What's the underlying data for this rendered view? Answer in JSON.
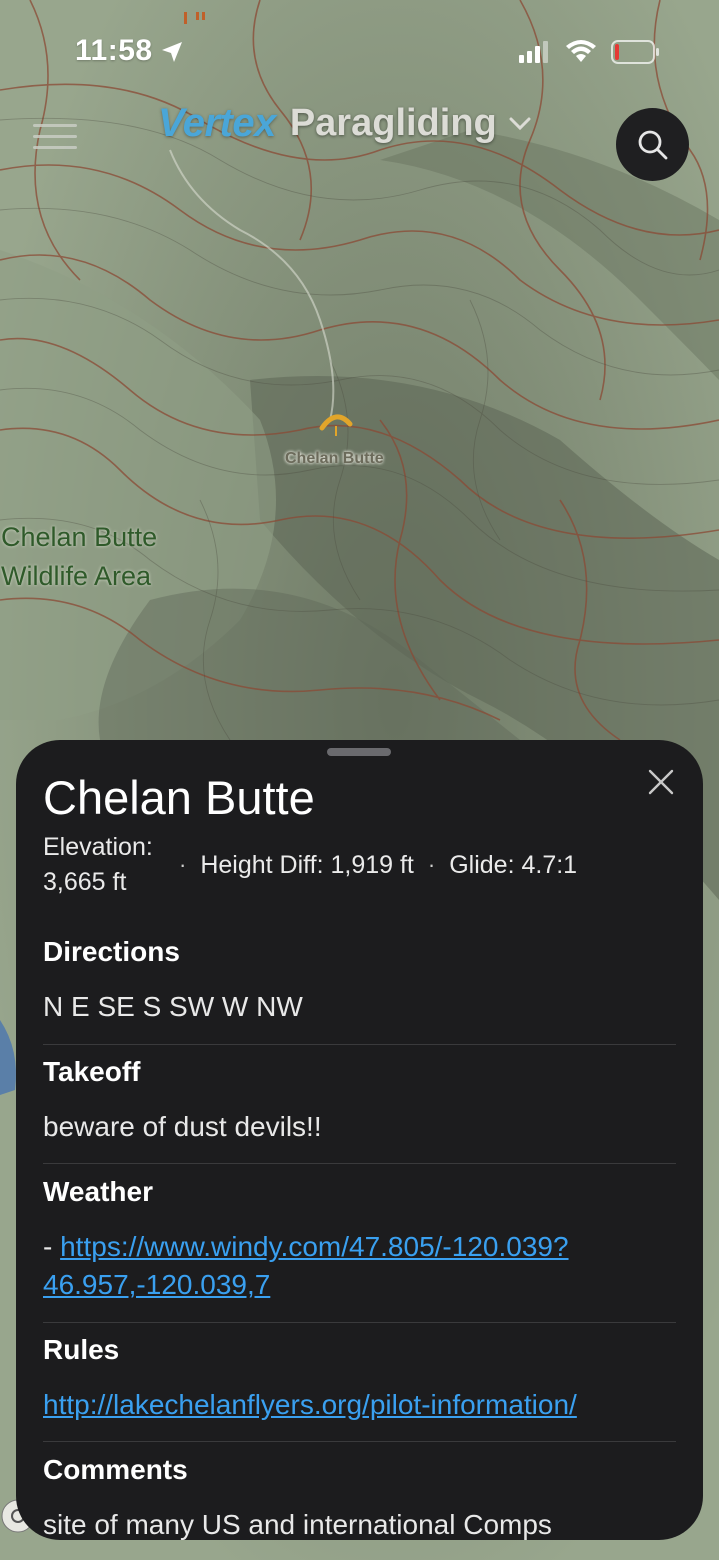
{
  "status_bar": {
    "time": "11:58"
  },
  "header": {
    "brand": "Vertex",
    "mode": "Paragliding"
  },
  "map": {
    "site_label": "Chelan Butte",
    "area_label_line1": "Chelan Butte",
    "area_label_line2": "Wildlife Area"
  },
  "sheet": {
    "title": "Chelan Butte",
    "elevation_label": "Elevation:",
    "elevation_value": "3,665 ft",
    "height_diff": "Height Diff: 1,919 ft",
    "glide": "Glide: 4.7:1",
    "sections": {
      "directions": {
        "heading": "Directions",
        "text": "N E SE S SW W NW"
      },
      "takeoff": {
        "heading": "Takeoff",
        "text": "beware of dust devils!!"
      },
      "weather": {
        "heading": "Weather",
        "prefix": "-",
        "link_line1": "https://www.windy.com/47.805/-120.039?",
        "link_line2": "46.957,-120.039,7"
      },
      "rules": {
        "heading": "Rules",
        "link": "http://lakechelanflyers.org/pilot-information/"
      },
      "comments": {
        "heading": "Comments",
        "text": "site of many US and international Comps"
      }
    }
  },
  "colors": {
    "sheet_bg": "#1c1c1e",
    "link": "#3aa0f0",
    "brand": "#4aa6d8",
    "map_base": "#8a9a80",
    "contour": "#8b4a35"
  },
  "icons": [
    "location-arrow-icon",
    "signal-icon",
    "wifi-icon",
    "battery-icon",
    "menu-icon",
    "search-icon",
    "close-icon",
    "paraglider-pin-icon",
    "chevron-down-icon"
  ]
}
